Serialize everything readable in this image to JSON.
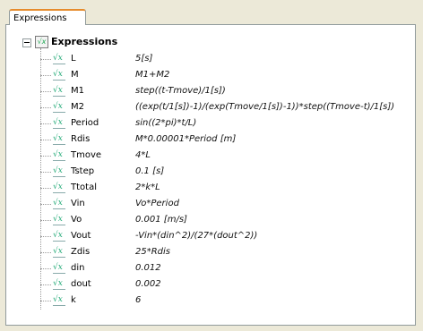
{
  "tab": {
    "label": "Expressions"
  },
  "tree": {
    "root_label": "Expressions",
    "items": [
      {
        "name": "L",
        "expr": "5[s]"
      },
      {
        "name": "M",
        "expr": "M1+M2"
      },
      {
        "name": "M1",
        "expr": "step((t-Tmove)/1[s])"
      },
      {
        "name": "M2",
        "expr": "((exp(t/1[s])-1)/(exp(Tmove/1[s])-1))*step((Tmove-t)/1[s])"
      },
      {
        "name": "Period",
        "expr": "sin((2*pi)*t/L)"
      },
      {
        "name": "Rdis",
        "expr": "M*0.00001*Period [m]"
      },
      {
        "name": "Tmove",
        "expr": "4*L"
      },
      {
        "name": "Tstep",
        "expr": "0.1 [s]"
      },
      {
        "name": "Ttotal",
        "expr": "2*k*L"
      },
      {
        "name": "Vin",
        "expr": "Vo*Period"
      },
      {
        "name": "Vo",
        "expr": "0.001 [m/s]"
      },
      {
        "name": "Vout",
        "expr": "-Vin*(din^2)/(27*(dout^2))"
      },
      {
        "name": "Zdis",
        "expr": "25*Rdis"
      },
      {
        "name": "din",
        "expr": "0.012"
      },
      {
        "name": "dout",
        "expr": "0.002"
      },
      {
        "name": "k",
        "expr": "6"
      }
    ]
  }
}
